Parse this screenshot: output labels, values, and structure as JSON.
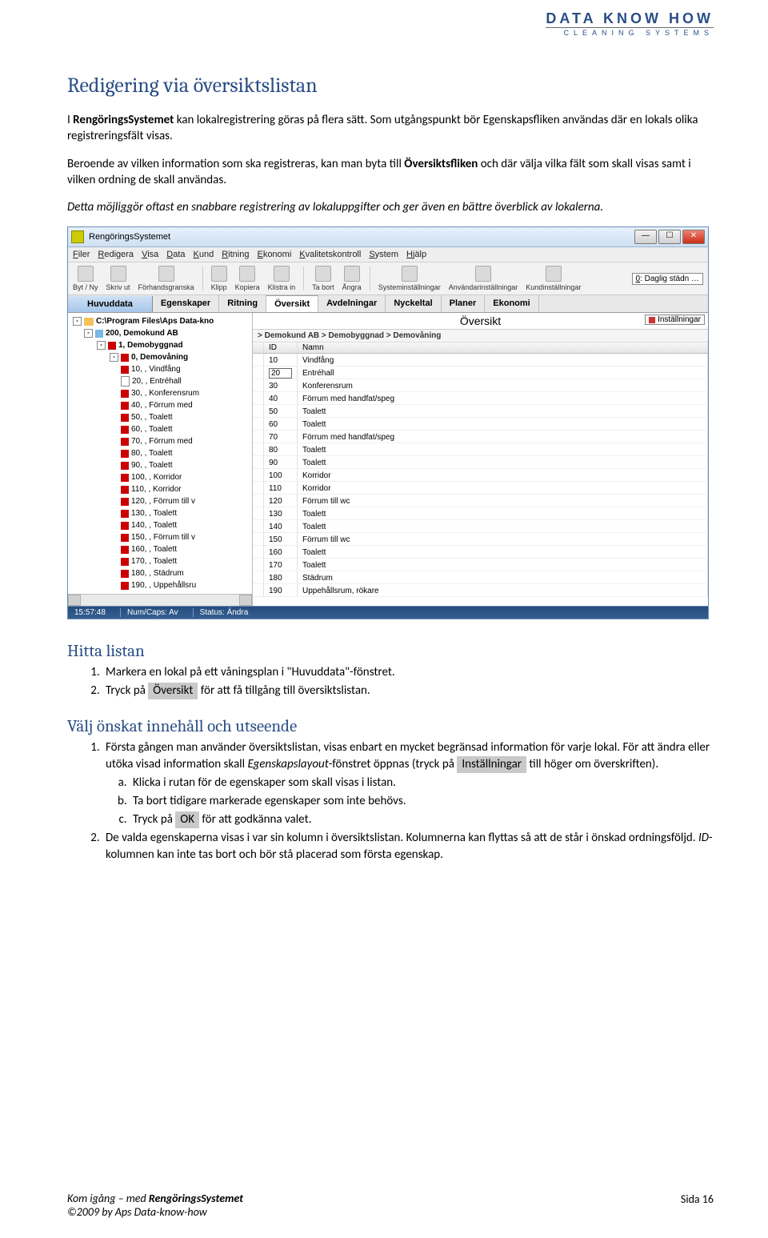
{
  "logo": {
    "main": "DATA KNOW HOW",
    "sub": "CLEANING SYSTEMS"
  },
  "doc": {
    "title": "Redigering via översiktslistan",
    "intro1_pre": "I ",
    "intro1_bold": "RengöringsSystemet",
    "intro1_post": " kan lokalregistrering göras på flera sätt. Som utgångspunkt bör Egenskapsfliken användas där en lokals olika registreringsfält visas.",
    "p2_pre": "Beroende av vilken information som ska registreras, kan man byta till ",
    "p2_bold": "Översiktsfliken",
    "p2_post": " och där välja vilka fält som skall visas samt i vilken ordning de skall användas.",
    "p3": "Detta möjliggör oftast en snabbare registrering av lokaluppgifter och ger även en bättre överblick av lokalerna.",
    "h_hitta": "Hitta listan",
    "hitta": {
      "li1": "Markera en lokal på ett våningsplan i \"Huvuddata\"-fönstret.",
      "li2_pre": "Tryck på ",
      "li2_btn": "Översikt",
      "li2_post": " för att få tillgång till översiktslistan."
    },
    "h_valj": "Välj önskat innehåll och utseende",
    "valj": {
      "li1_part1": "Första gången man använder översiktslistan, visas enbart en mycket begränsad information för varje lokal. För att ändra eller utöka visad information skall ",
      "li1_em": "Egenskapslayout",
      "li1_part2": "-fönstret öppnas (tryck på ",
      "li1_btn": "Inställningar",
      "li1_part3": " till höger om överskriften).",
      "a": "Klicka i rutan för de egenskaper som skall visas i listan.",
      "b": "Ta bort tidigare markerade egenskaper som inte behövs.",
      "c_pre": "Tryck på ",
      "c_btn": "OK",
      "c_post": " för att godkänna valet.",
      "li2_part1": "De valda egenskaperna visas i var sin kolumn i översiktslistan. Kolumnerna kan flyttas så att de står i önskad ordningsföljd. ",
      "li2_em": "ID",
      "li2_part2": "-kolumnen kan inte tas bort och bör stå placerad som första egenskap."
    }
  },
  "footer": {
    "line1_pre": "Kom igång – med ",
    "line1_bold": "RengöringsSystemet",
    "line2": "©2009 by Aps Data-know-how",
    "pagelabel": "Sida 16"
  },
  "app": {
    "title": "RengöringsSystemet",
    "menu": [
      "Filer",
      "Redigera",
      "Visa",
      "Data",
      "Kund",
      "Ritning",
      "Ekonomi",
      "Kvalitetskontroll",
      "System",
      "Hjälp"
    ],
    "toolbar": [
      "Byt / Ny",
      "Skriv ut",
      "Förhandsgranska",
      "Klipp",
      "Kopiera",
      "Klistra in",
      "Ta bort",
      "Ångra",
      "Systeminställningar",
      "Användarinställningar",
      "Kundinställningar"
    ],
    "periodLabel": "0: Daglig städn",
    "tabs": {
      "huvud": "Huvuddata",
      "list": [
        "Egenskaper",
        "Ritning",
        "Översikt",
        "Avdelningar",
        "Nyckeltal",
        "Planer",
        "Ekonomi"
      ]
    },
    "overviewTitle": "Översikt",
    "instBtn": "Inställningar",
    "breadcrumb": "> Demokund AB > Demobyggnad > Demovåning",
    "gridHeaders": {
      "id": "ID",
      "namn": "Namn"
    },
    "treeRoot": "C:\\Program Files\\Aps Data-kno",
    "treeKund": "200, Demokund AB",
    "treeByggnad": "1, Demobyggnad",
    "treeVaning": "0, Demovåning",
    "treeRooms": [
      "10, , Vindfång",
      "20, , Entréhall",
      "30, , Konferensrum",
      "40, , Förrum med",
      "50, , Toalett",
      "60, , Toalett",
      "70, , Förrum med",
      "80, , Toalett",
      "90, , Toalett",
      "100, , Korridor",
      "110, , Korridor",
      "120, , Förrum till v",
      "130, , Toalett",
      "140, , Toalett",
      "150, , Förrum till v",
      "160, , Toalett",
      "170, , Toalett",
      "180, , Städrum",
      "190, , Uppehållsru"
    ],
    "gridRows": [
      {
        "id": "10",
        "namn": "Vindfång"
      },
      {
        "id": "20",
        "namn": "Entréhall",
        "edit": true
      },
      {
        "id": "30",
        "namn": "Konferensrum"
      },
      {
        "id": "40",
        "namn": "Förrum med handfat/speg"
      },
      {
        "id": "50",
        "namn": "Toalett"
      },
      {
        "id": "60",
        "namn": "Toalett"
      },
      {
        "id": "70",
        "namn": "Förrum med handfat/speg"
      },
      {
        "id": "80",
        "namn": "Toalett"
      },
      {
        "id": "90",
        "namn": "Toalett"
      },
      {
        "id": "100",
        "namn": "Korridor"
      },
      {
        "id": "110",
        "namn": "Korridor"
      },
      {
        "id": "120",
        "namn": "Förrum till wc"
      },
      {
        "id": "130",
        "namn": "Toalett"
      },
      {
        "id": "140",
        "namn": "Toalett"
      },
      {
        "id": "150",
        "namn": "Förrum till wc"
      },
      {
        "id": "160",
        "namn": "Toalett"
      },
      {
        "id": "170",
        "namn": "Toalett"
      },
      {
        "id": "180",
        "namn": "Städrum"
      },
      {
        "id": "190",
        "namn": "Uppehållsrum, rökare"
      }
    ],
    "status": {
      "time": "15:57:48",
      "caps": "Num/Caps: Av",
      "status": "Status: Ändra"
    }
  }
}
